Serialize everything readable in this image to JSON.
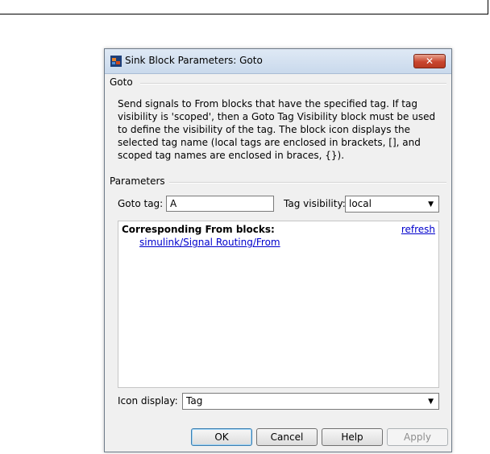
{
  "dialog": {
    "title": "Sink Block Parameters: Goto",
    "close_glyph": "✕"
  },
  "block_group": {
    "label": "Goto",
    "description": "Send signals to From blocks that have the specified tag.  If tag visibility is 'scoped', then a Goto Tag Visibility block must be used to define the visibility of the tag.  The block icon displays the selected tag name (local tags are enclosed in brackets, [], and scoped tag names are enclosed in braces, {})."
  },
  "parameters": {
    "label": "Parameters",
    "goto_tag_label": "Goto tag:",
    "goto_tag_value": "A",
    "tag_visibility_label": "Tag visibility:",
    "tag_visibility_value": "local",
    "corresponding_heading": "Corresponding From blocks:",
    "refresh_link": "refresh",
    "from_blocks": [
      "simulink/Signal Routing/From"
    ],
    "icon_display_label": "Icon display:",
    "icon_display_value": "Tag"
  },
  "buttons": {
    "ok": "OK",
    "cancel": "Cancel",
    "help": "Help",
    "apply": "Apply"
  },
  "icons": [
    "simulink-block-icon",
    "close-icon",
    "dropdown-arrow-icon"
  ]
}
